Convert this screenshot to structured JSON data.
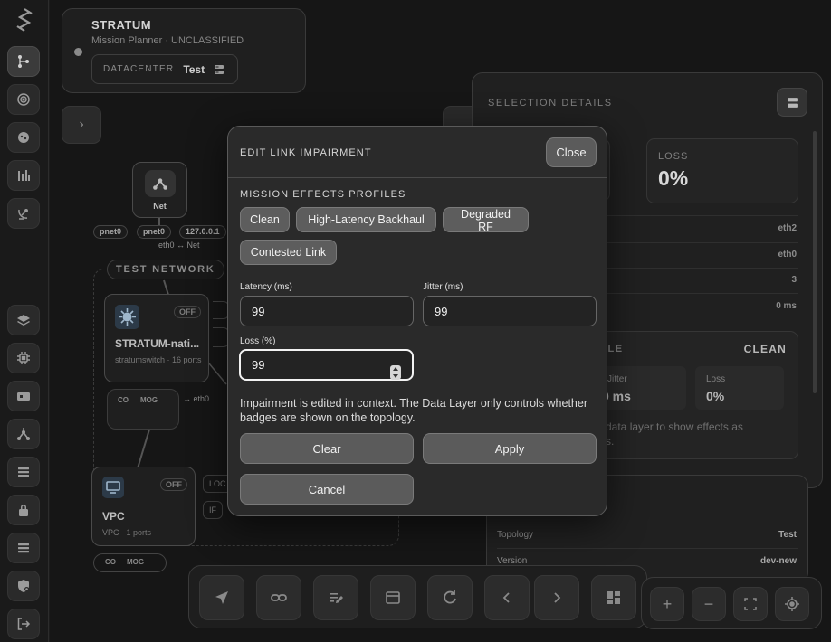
{
  "app": {
    "name": "STRATUM",
    "subtitle": "Mission Planner · UNCLASSIFIED",
    "datacenter_label": "DATACENTER",
    "datacenter_value": "Test"
  },
  "topology": {
    "net_node_label": "Net",
    "pills_top": [
      "pnet0",
      "pnet0",
      "127.0.0.1"
    ],
    "edge_label": "eth0 ↔ Net",
    "network_label": "TEST NETWORK",
    "switch_name": "STRATUM-nati...",
    "switch_sub": "stratumswitch · 16 ports",
    "switch_state": "OFF",
    "co_pills": [
      "CO",
      "MOG"
    ],
    "eth_label": "eth0",
    "vpc_name": "VPC",
    "vpc_sub": "VPC · 1 ports",
    "vpc_state": "OFF",
    "vpc_pills": [
      "CO",
      "MOG"
    ],
    "partial_labels": [
      "LOC",
      "IF"
    ]
  },
  "selection": {
    "title": "SELECTION DETAILS",
    "loss_label": "LOSS",
    "loss_value": "0%",
    "rows": [
      "eth2",
      "eth0",
      "3",
      "0 ms"
    ],
    "profile_label_partial": "ILE",
    "profile_value": "CLEAN",
    "jitter_label": "Jitter",
    "jitter_value": "0 ms",
    "loss_small_label": "Loss",
    "loss_small_value": "0%",
    "hint_partial_1": "data layer to show effects as",
    "hint_partial_2": "s.",
    "info_rows": [
      {
        "label": "Topology",
        "value": "Test"
      },
      {
        "label": "Version",
        "value": "dev-new"
      }
    ]
  },
  "modal": {
    "title": "EDIT LINK IMPAIRMENT",
    "close_label": "Close",
    "profiles_label": "MISSION EFFECTS PROFILES",
    "profiles": [
      "Clean",
      "High-Latency Backhaul",
      "Degraded RF",
      "Contested Link"
    ],
    "latency_label": "Latency (ms)",
    "latency_value": "99",
    "jitter_label": "Jitter (ms)",
    "jitter_value": "99",
    "loss_label": "Loss (%)",
    "loss_value": "99",
    "hint": "Impairment is edited in context. The Data Layer only controls whether badges are shown on the topology.",
    "clear_label": "Clear",
    "apply_label": "Apply",
    "cancel_label": "Cancel"
  },
  "toolbar": {
    "icons": [
      "navigate-icon",
      "link-icon",
      "edit-icon",
      "window-icon",
      "refresh-icon",
      "chevron-left-icon",
      "chevron-right-icon",
      "dashboard-icon"
    ],
    "zoom_icons": [
      "zoom-in-icon",
      "zoom-out-icon",
      "fit-view-icon",
      "locate-icon"
    ],
    "zoom_in": "+",
    "zoom_out": "−"
  }
}
